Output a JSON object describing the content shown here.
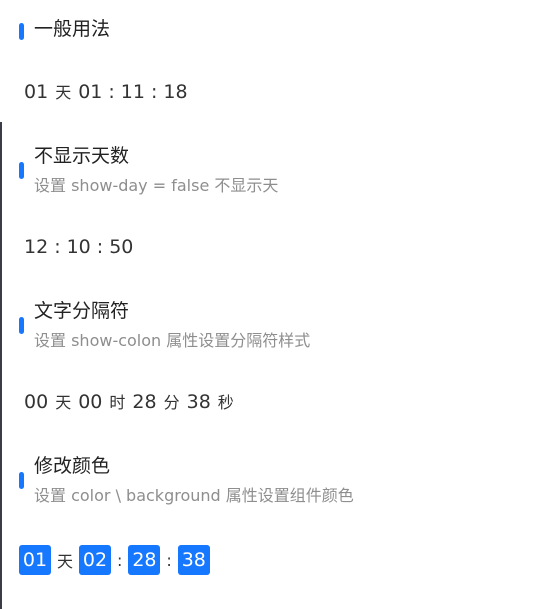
{
  "sections": [
    {
      "title": "一般用法",
      "countdown": {
        "days": "01",
        "day_unit": "天",
        "hours": "01",
        "minutes": "11",
        "seconds": "18",
        "colon": ":"
      }
    },
    {
      "title": "不显示天数",
      "description": "设置 show-day = false 不显示天",
      "countdown": {
        "hours": "12",
        "minutes": "10",
        "seconds": "50",
        "colon": ":"
      }
    },
    {
      "title": "文字分隔符",
      "description": "设置 show-colon 属性设置分隔符样式",
      "countdown": {
        "days": "00",
        "day_unit": "天",
        "hours": "00",
        "hour_unit": "时",
        "minutes": "28",
        "minute_unit": "分",
        "seconds": "38",
        "second_unit": "秒"
      }
    },
    {
      "title": "修改颜色",
      "description": "设置 color \\ background 属性设置组件颜色",
      "countdown": {
        "days": "01",
        "day_unit": "天",
        "hours": "02",
        "minutes": "28",
        "seconds": "38",
        "colon": ":"
      }
    }
  ],
  "colors": {
    "accent": "#1677ff",
    "title_text": "#222222",
    "description_text": "#8e8e8e"
  }
}
